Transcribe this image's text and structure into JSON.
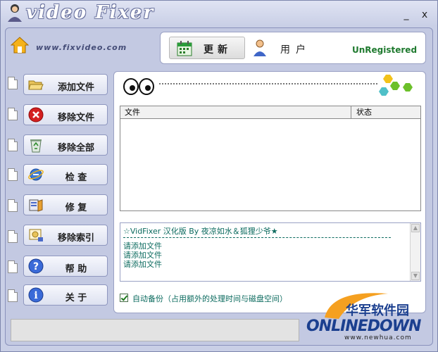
{
  "app": {
    "title": "video Fixer",
    "url": "www.fixvideo.com"
  },
  "window": {
    "minimize": "_",
    "close": "x"
  },
  "toolbar": {
    "update_label": "更新",
    "user_label": "用户",
    "registration": "UnRegistered"
  },
  "sidebar": {
    "items": [
      {
        "label": "添加文件",
        "icon": "folder-open-icon"
      },
      {
        "label": "移除文件",
        "icon": "red-x-icon"
      },
      {
        "label": "移除全部",
        "icon": "recycle-bin-icon"
      },
      {
        "label": "检 查",
        "icon": "ie-globe-icon"
      },
      {
        "label": "修 复",
        "icon": "repair-tools-icon"
      },
      {
        "label": "移除索引",
        "icon": "index-remove-icon"
      },
      {
        "label": "帮 助",
        "icon": "help-icon"
      },
      {
        "label": "关 于",
        "icon": "info-icon"
      }
    ]
  },
  "filelist": {
    "columns": [
      "文件",
      "状态"
    ],
    "rows": []
  },
  "log": {
    "title": "☆VidFixer 汉化版 By 夜凉如水＆狐狸少爷★",
    "lines": [
      "请添加文件",
      "请添加文件",
      "请添加文件"
    ]
  },
  "options": {
    "auto_backup_label": "自动备份（占用额外的处理时间与磁盘空间）",
    "auto_backup_checked": true
  },
  "watermark": {
    "cn": "华军软件园",
    "en": "ONLINEDOWN",
    "url": "www.newhua.com"
  },
  "colors": {
    "background": "#c9cfe6",
    "accent_green": "#1f7a2f",
    "log_text": "#0c6b5f"
  }
}
